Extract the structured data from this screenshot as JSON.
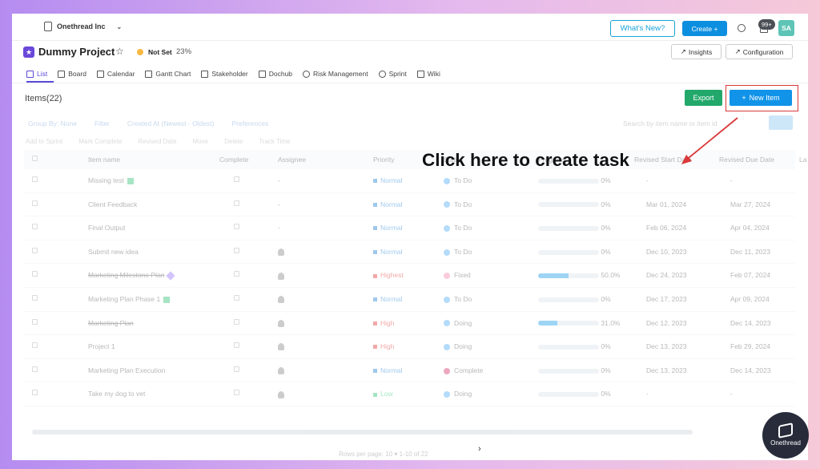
{
  "header": {
    "org_name": "Onethread Inc",
    "whats_new": "What's New?",
    "create": "Create +",
    "notif_badge": "99+",
    "avatar_initials": "SA"
  },
  "project": {
    "title": "Dummy Project",
    "status": "Not Set",
    "percent": "23%",
    "insights": "Insights",
    "configuration": "Configuration"
  },
  "tabs": [
    {
      "label": "List",
      "icon": "list-icon"
    },
    {
      "label": "Board",
      "icon": "board-icon"
    },
    {
      "label": "Calendar",
      "icon": "calendar-icon"
    },
    {
      "label": "Gantt Chart",
      "icon": "gantt-icon"
    },
    {
      "label": "Stakeholder",
      "icon": "stakeholder-icon"
    },
    {
      "label": "Dochub",
      "icon": "dochub-icon"
    },
    {
      "label": "Risk Management",
      "icon": "risk-icon"
    },
    {
      "label": "Sprint",
      "icon": "sprint-icon"
    },
    {
      "label": "Wiki",
      "icon": "wiki-icon"
    }
  ],
  "items": {
    "title": "Items",
    "count": "(22)",
    "export": "Export",
    "new_item": "New Item"
  },
  "filters": {
    "group_by": "Group By: None",
    "filter": "Filter",
    "sort": "Created At (Newest - Oldest)",
    "preferences": "Preferences",
    "search_placeholder": "Search by item name or item id"
  },
  "actions": [
    "Add to Sprint",
    "Mark Complete",
    "Revised Date",
    "Move",
    "Delete",
    "Track Time"
  ],
  "table": {
    "headers": [
      "Item name",
      "Complete",
      "Assignee",
      "Priority",
      "Status",
      "Progress",
      "Revised Start Date",
      "Revised Due Date",
      "La"
    ],
    "rows": [
      {
        "name": "Missing test",
        "assignee": "-",
        "priority": "Normal",
        "status": "To Do",
        "progress": "0%",
        "start": "-",
        "due": "-"
      },
      {
        "name": "Client Feedback",
        "assignee": "-",
        "priority": "Normal",
        "status": "To Do",
        "progress": "0%",
        "start": "Mar 01, 2024",
        "due": "Mar 27, 2024"
      },
      {
        "name": "Final Output",
        "assignee": "-",
        "priority": "Normal",
        "status": "To Do",
        "progress": "0%",
        "start": "Feb 06, 2024",
        "due": "Apr 04, 2024"
      },
      {
        "name": "Submit new idea",
        "assignee": "",
        "priority": "Normal",
        "status": "To Do",
        "progress": "0%",
        "start": "Dec 10, 2023",
        "due": "Dec 11, 2023"
      },
      {
        "name": "Marketing Milestone Plan",
        "assignee": "",
        "priority": "Highest",
        "status": "Fixed",
        "progress": "50.0%",
        "start": "Dec 24, 2023",
        "due": "Feb 07, 2024"
      },
      {
        "name": "Marketing Plan Phase 1",
        "assignee": "",
        "priority": "Normal",
        "status": "To Do",
        "progress": "0%",
        "start": "Dec 17, 2023",
        "due": "Apr 09, 2024"
      },
      {
        "name": "Marketing Plan",
        "assignee": "",
        "priority": "High",
        "status": "Doing",
        "progress": "31.0%",
        "start": "Dec 12, 2023",
        "due": "Dec 14, 2023"
      },
      {
        "name": "Project 1",
        "assignee": "",
        "priority": "High",
        "status": "Doing",
        "progress": "0%",
        "start": "Dec 13, 2023",
        "due": "Feb 29, 2024"
      },
      {
        "name": "Marketing Plan Execution",
        "assignee": "",
        "priority": "Normal",
        "status": "Complete",
        "progress": "0%",
        "start": "Dec 13, 2023",
        "due": "Dec 14, 2023"
      },
      {
        "name": "Take my dog to vet",
        "assignee": "",
        "priority": "Low",
        "status": "Doing",
        "progress": "0%",
        "start": "-",
        "due": "-"
      }
    ]
  },
  "pager": "Rows per page: 10 ▾ 1-10 of 22",
  "annotation": "Click here to create task",
  "brand": "Onethread",
  "colors": {
    "accent": "#1093e8",
    "export_green": "#22a86b",
    "annotation_red": "#d9383a",
    "tab_active": "#5b4ad6"
  }
}
